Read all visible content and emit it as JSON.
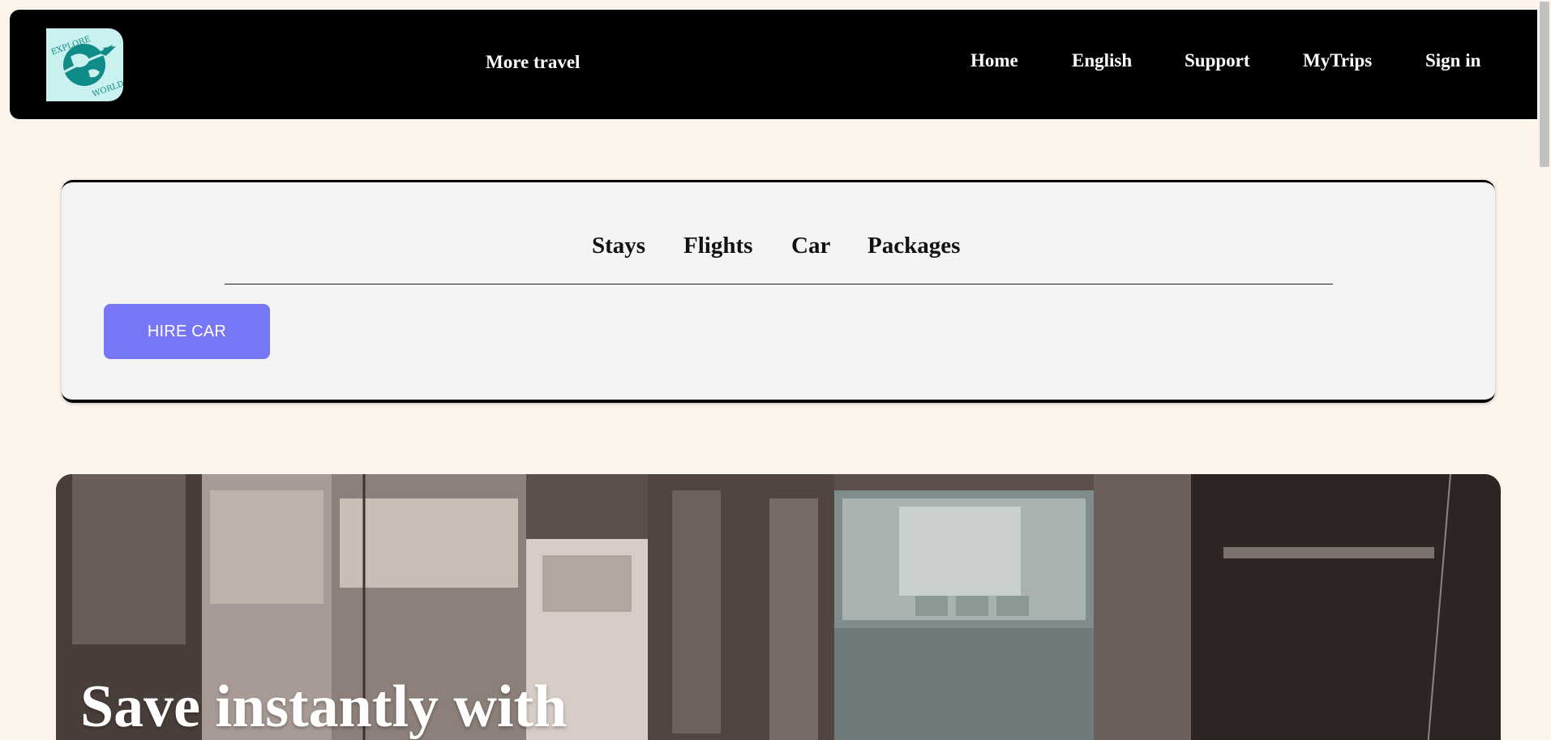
{
  "header": {
    "logo_text_top": "EXPLORE",
    "logo_text_bottom": "WORLD",
    "tagline": "More travel",
    "nav": [
      {
        "label": "Home"
      },
      {
        "label": "English"
      },
      {
        "label": "Support"
      },
      {
        "label": "MyTrips"
      },
      {
        "label": "Sign in"
      }
    ]
  },
  "search_panel": {
    "tabs": [
      {
        "label": "Stays"
      },
      {
        "label": "Flights"
      },
      {
        "label": "Car"
      },
      {
        "label": "Packages"
      }
    ],
    "hire_button": "HIRE CAR"
  },
  "hero": {
    "title": "Save instantly with"
  },
  "colors": {
    "page_bg": "#fdf5ec",
    "header_bg": "#000000",
    "logo_bg": "#c9f1ef",
    "logo_teal": "#0f8b88",
    "button_bg": "#7676f7",
    "panel_bg": "#f4f4f4"
  },
  "icons": {
    "logo": "globe-airplane-logo-icon"
  }
}
